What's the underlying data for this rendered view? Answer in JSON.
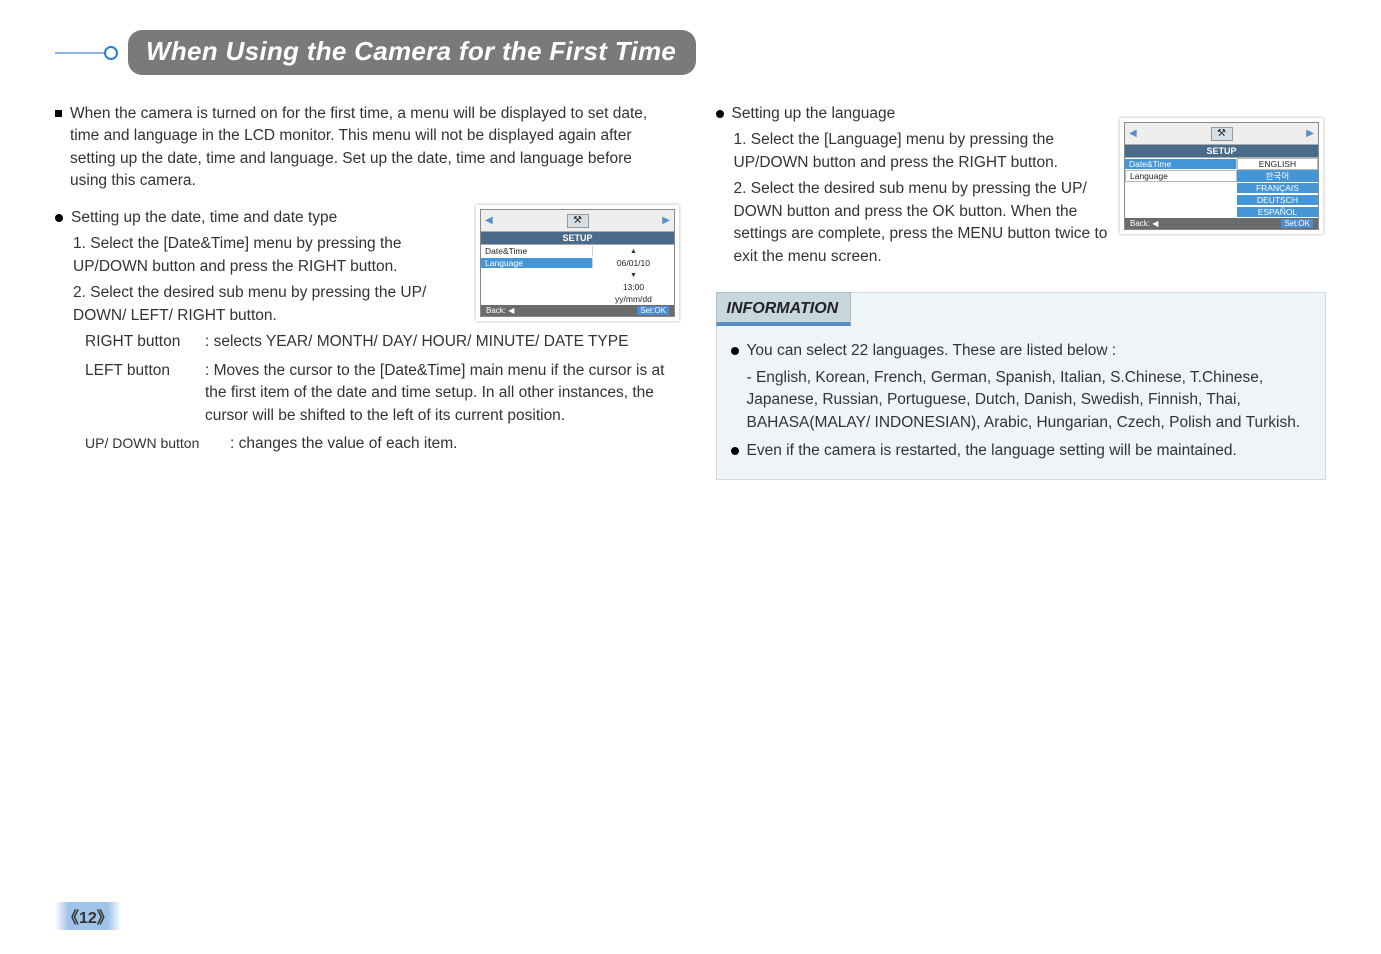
{
  "title": "When Using the Camera for the First Time",
  "left": {
    "intro": "When the camera is turned on for the first time, a menu will be displayed to set date, time and language in the LCD monitor. This menu will not be displayed again after setting up the date, time and language. Set up the date, time and language before using this camera.",
    "section1_title": "Setting up the date, time and date type",
    "step1": "1. Select the [Date&Time] menu by pressing the UP/DOWN button and press the RIGHT button.",
    "step2": "2. Select the desired sub menu by pressing the UP/ DOWN/ LEFT/ RIGHT button.",
    "right_btn_label": "RIGHT button",
    "right_btn_desc": ": selects YEAR/ MONTH/ DAY/ HOUR/ MINUTE/ DATE TYPE",
    "left_btn_label": "LEFT button",
    "left_btn_desc": ": Moves the cursor to the [Date&Time] main menu if the cursor is at the first item of the date and time setup. In all other instances, the cursor will be shifted to the left of its current position.",
    "ud_btn_label": "UP/ DOWN button",
    "ud_btn_desc": ": changes the value of each item."
  },
  "right": {
    "section2_title": "Setting up the language",
    "step1": "1. Select the [Language] menu by pressing the UP/DOWN button and press the RIGHT button.",
    "step2": "2. Select the desired sub menu by pressing the UP/ DOWN button and press the OK button. When the settings are complete, press the MENU button twice to exit the menu screen."
  },
  "info": {
    "heading": "INFORMATION",
    "p1": "You can select 22 languages. These are listed below :",
    "p1a": "- English, Korean, French, German, Spanish, Italian, S.Chinese, T.Chinese, Japanese, Russian, Portuguese, Dutch, Danish, Swedish, Finnish, Thai, BAHASA(MALAY/ INDONESIAN), Arabic, Hungarian, Czech, Polish and Turkish.",
    "p2": "Even if the camera is restarted, the language setting will be maintained."
  },
  "setup1": {
    "title": "SETUP",
    "row1": "Date&Time",
    "row2": "Language",
    "val_date": "06/01/10",
    "val_time": "13:00",
    "val_fmt": "yy/mm/dd",
    "back": "Back: ◀",
    "set": "Set:OK"
  },
  "setup2": {
    "title": "SETUP",
    "row1": "Date&Time",
    "row2": "Language",
    "opt1": "ENGLISH",
    "opt2": "한국어",
    "opt3": "FRANÇAIS",
    "opt4": "DEUTSCH",
    "opt5": "ESPAÑOL",
    "back": "Back: ◀",
    "set": "Set:OK"
  },
  "page": "《12》"
}
